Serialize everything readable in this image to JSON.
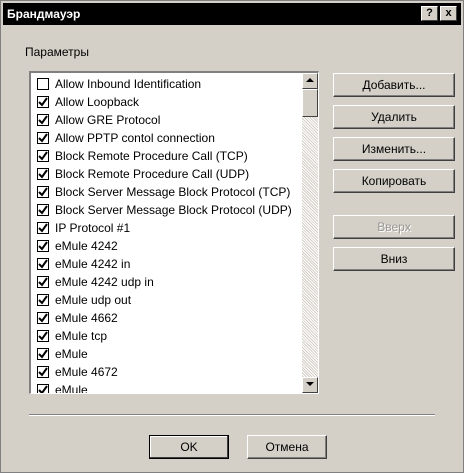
{
  "window": {
    "title": "Брандмауэр",
    "help_button": "?",
    "close_button": "x"
  },
  "params_label": "Параметры",
  "list_items": [
    {
      "label": "Allow Inbound Identification",
      "checked": false
    },
    {
      "label": "Allow Loopback",
      "checked": true
    },
    {
      "label": "Allow GRE Protocol",
      "checked": true
    },
    {
      "label": "Allow PPTP contol connection",
      "checked": true
    },
    {
      "label": "Block Remote Procedure Call (TCP)",
      "checked": true
    },
    {
      "label": "Block Remote Procedure Call (UDP)",
      "checked": true
    },
    {
      "label": "Block Server Message Block Protocol (TCP)",
      "checked": true
    },
    {
      "label": "Block Server Message Block Protocol (UDP)",
      "checked": true
    },
    {
      "label": "IP Protocol #1",
      "checked": true
    },
    {
      "label": "eMule 4242",
      "checked": true
    },
    {
      "label": "eMule 4242 in",
      "checked": true
    },
    {
      "label": "eMule 4242 udp in",
      "checked": true
    },
    {
      "label": "eMule udp out",
      "checked": true
    },
    {
      "label": "eMule 4662",
      "checked": true
    },
    {
      "label": "eMule tcp",
      "checked": true
    },
    {
      "label": "eMule",
      "checked": true
    },
    {
      "label": "eMule 4672",
      "checked": true
    },
    {
      "label": "eMule",
      "checked": true
    }
  ],
  "side_buttons": {
    "add": "Добавить...",
    "delete": "Удалить",
    "edit": "Изменить...",
    "copy": "Копировать",
    "up": "Вверх",
    "down": "Вниз"
  },
  "footer_buttons": {
    "ok": "OK",
    "cancel": "Отмена"
  }
}
